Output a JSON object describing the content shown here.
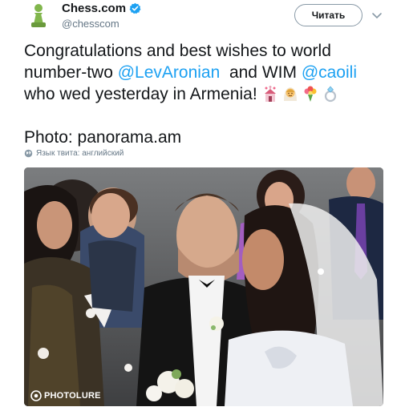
{
  "author": {
    "display_name": "Chess.com",
    "handle": "@chesscom",
    "verified_icon": "verified-badge-icon",
    "avatar_icon": "pawn-logo-icon"
  },
  "actions": {
    "follow_label": "Читать",
    "menu_icon": "chevron-down-icon"
  },
  "tweet": {
    "line1": "Congratulations and best wishes to world",
    "line2_prefix": "number-two ",
    "mention1": "@LevAronian",
    "line2_mid": "  and WIM ",
    "mention2": "@caoili",
    "line3_text": "who wed yesterday in Armenia! ",
    "emojis": [
      "wedding-chapel-icon",
      "bride-icon",
      "bouquet-icon",
      "ring-icon"
    ],
    "photo_credit": "Photo: panorama.am"
  },
  "language_note": "Язык твита: английский",
  "media": {
    "watermark": "PHOTOLURE"
  },
  "colors": {
    "link": "#1da1f2",
    "verified": "#1da1f2",
    "logo_green": "#81b64c",
    "text": "#14171a",
    "muted": "#657786"
  }
}
